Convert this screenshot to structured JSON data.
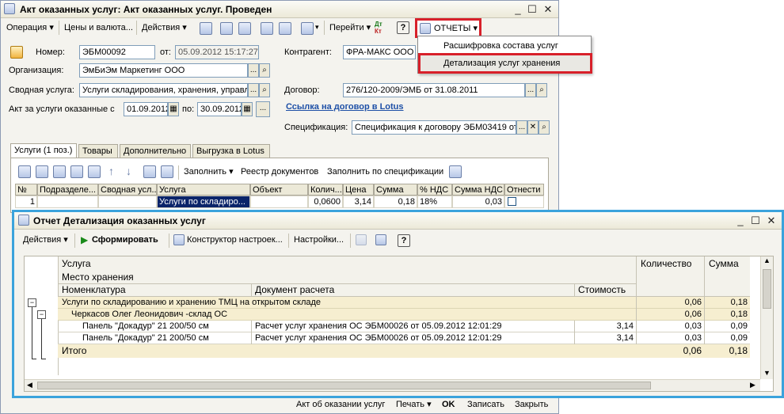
{
  "doc_window": {
    "title": "Акт оказанных услуг: Акт оказанных услуг. Проведен",
    "toolbar": {
      "operation": "Операция",
      "prices": "Цены и валюта...",
      "actions": "Действия",
      "goto": "Перейти",
      "reports": "ОТЧЕТЫ"
    },
    "reports_menu": {
      "items": [
        "Расшифровка состава услуг",
        "Детализация услуг хранения"
      ]
    },
    "form": {
      "number_label": "Номер:",
      "number_value": "ЭБМ00092",
      "from_label": "от:",
      "date_value": "05.09.2012 15:17:27",
      "counterparty_label": "Контрагент:",
      "counterparty_value": "ФРА-МАКС ООО",
      "org_label": "Организация:",
      "org_value": "ЭмБиЭм Маркетинг ООО",
      "summary_service_label": "Сводная услуга:",
      "summary_service_value": "Услуги складирования, хранения, управл",
      "contract_label": "Договор:",
      "contract_value": "276/120-2009/ЭМБ от 31.08.2011",
      "act_period_label": "Акт за услуги оказанные с",
      "period_from": "01.09.2012",
      "period_to_label": "по:",
      "period_to": "30.09.2012",
      "lotus_link": "Ссылка на договор в Lotus",
      "spec_label": "Спецификация:",
      "spec_value": "Спецификация к договору ЭБМ03419 от"
    },
    "tabs": [
      "Услуги (1 поз.)",
      "Товары",
      "Дополнительно",
      "Выгрузка в Lotus"
    ],
    "grid_toolbar": {
      "fill": "Заполнить",
      "doc_registry": "Реестр документов",
      "fill_by_spec": "Заполнить по спецификации"
    },
    "grid": {
      "headers": [
        "№",
        "Подразделе...",
        "Сводная усл...",
        "Услуга",
        "Объект",
        "Колич...",
        "Цена",
        "Сумма",
        "% НДС",
        "Сумма НДС",
        "Отнести н"
      ],
      "row": [
        "1",
        "",
        "",
        "Услуги по складиро...",
        "",
        "0,0600",
        "3,14",
        "0,18",
        "18%",
        "0,03",
        ""
      ]
    },
    "bottom_bar": {
      "act_label": "Акт об оказании услуг",
      "print": "Печать",
      "ok": "OK",
      "save": "Записать",
      "close": "Закрыть"
    }
  },
  "report_window": {
    "title": "Отчет  Детализация оказанных услуг",
    "toolbar": {
      "actions": "Действия",
      "generate": "Сформировать",
      "constructor": "Конструктор настроек...",
      "settings": "Настройки..."
    },
    "header": {
      "service": "Услуга",
      "storage_place": "Место хранения",
      "nomenclature": "Номенклатура",
      "settlement_doc": "Документ расчета",
      "cost": "Стоимость",
      "quantity": "Количество",
      "sum": "Сумма"
    },
    "rows": [
      {
        "level": 0,
        "name": "Услуги по складированию и хранению ТМЦ на открытом складе",
        "doc": "",
        "cost": "",
        "qty": "0,06",
        "sum": "0,18"
      },
      {
        "level": 1,
        "name": "Черкасов Олег Леонидович -склад ОС",
        "doc": "",
        "cost": "",
        "qty": "0,06",
        "sum": "0,18"
      },
      {
        "level": 2,
        "name": "Панель \"Докадур\" 21 200/50 см",
        "doc": "Расчет услуг хранения ОС ЭБМ00026 от 05.09.2012 12:01:29",
        "cost": "3,14",
        "qty": "0,03",
        "sum": "0,09"
      },
      {
        "level": 2,
        "name": "Панель \"Докадур\" 21 200/50 см",
        "doc": "Расчет услуг хранения ОС ЭБМ00026 от 05.09.2012 12:01:29",
        "cost": "3,14",
        "qty": "0,03",
        "sum": "0,09"
      }
    ],
    "total": {
      "label": "Итого",
      "qty": "0,06",
      "sum": "0,18"
    }
  },
  "colors": {
    "highlight_red": "#d8202a",
    "report_frame_blue": "#3ba3dc",
    "group_row": "#f6eed0",
    "selected_cell": "#0a246a"
  }
}
